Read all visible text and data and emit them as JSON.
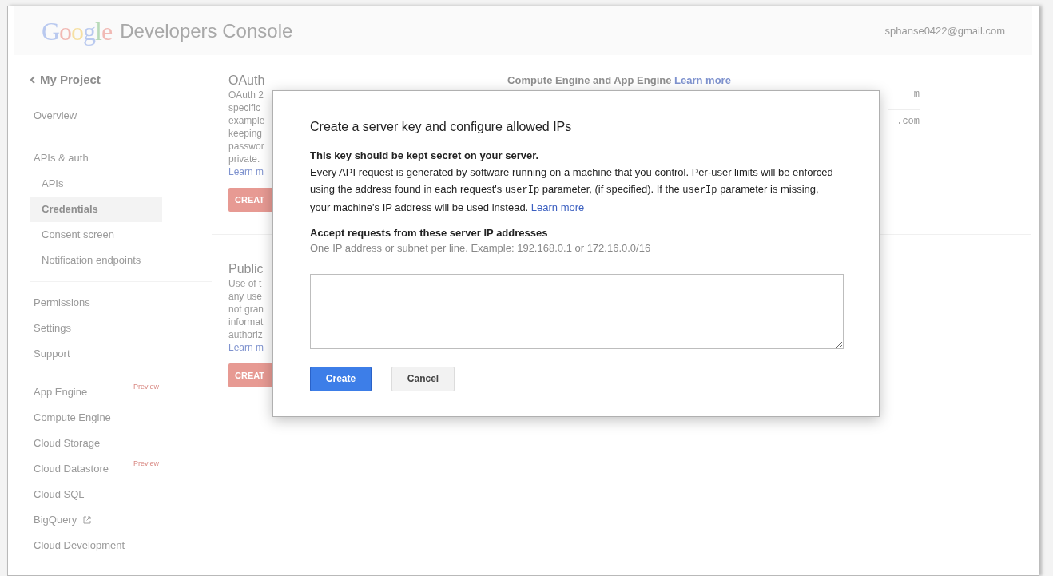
{
  "header": {
    "logo": "Google",
    "product": "Developers Console",
    "account": "sphanse0422@gmail.com"
  },
  "sidebar": {
    "back_label": "My Project",
    "groups": [
      {
        "items": [
          {
            "label": "Overview",
            "selected": false
          }
        ]
      },
      {
        "items": [
          {
            "label": "APIs & auth",
            "selected": false,
            "children": [
              {
                "label": "APIs",
                "selected": false
              },
              {
                "label": "Credentials",
                "selected": true
              },
              {
                "label": "Consent screen",
                "selected": false
              },
              {
                "label": "Notification endpoints",
                "selected": false
              }
            ]
          }
        ]
      },
      {
        "items": [
          {
            "label": "Permissions",
            "selected": false
          },
          {
            "label": "Settings",
            "selected": false
          },
          {
            "label": "Support",
            "selected": false
          }
        ]
      },
      {
        "items": [
          {
            "label": "App Engine",
            "selected": false,
            "badge": "Preview"
          },
          {
            "label": "Compute Engine",
            "selected": false
          },
          {
            "label": "Cloud Storage",
            "selected": false
          },
          {
            "label": "Cloud Datastore",
            "selected": false,
            "badge": "Preview"
          },
          {
            "label": "Cloud SQL",
            "selected": false
          },
          {
            "label": "BigQuery",
            "selected": false,
            "external": true
          },
          {
            "label": "Cloud Development",
            "selected": false
          }
        ]
      }
    ]
  },
  "background": {
    "sections": [
      {
        "title": "OAuth",
        "lines": [
          "OAuth 2",
          "specific",
          "example",
          "keeping",
          "passwor",
          "private."
        ],
        "link": "Learn m",
        "button": "CREAT"
      },
      {
        "title": "Public",
        "lines": [
          "Use of t",
          "any use",
          "not gran",
          "informat",
          "authoriz"
        ],
        "link": "Learn m",
        "button": "CREAT"
      }
    ],
    "heading": {
      "text": "Compute Engine and App Engine",
      "link": "Learn more"
    },
    "right_fragments": [
      {
        "kind": "text",
        "text": "m"
      },
      {
        "kind": "field",
        "text": ".com"
      }
    ]
  },
  "dialog": {
    "title": "Create a server key and configure allowed IPs",
    "warning": "This key should be kept secret on your server.",
    "description": [
      {
        "kind": "text",
        "text": "Every API request is generated by software running on a machine that you control. Per-user limits will be enforced using the address found in each request's "
      },
      {
        "kind": "code",
        "text": "userIp"
      },
      {
        "kind": "text",
        "text": " parameter, (if specified). If the "
      },
      {
        "kind": "code",
        "text": "userIp"
      },
      {
        "kind": "text",
        "text": " parameter is missing, your machine's IP address will be used instead. "
      },
      {
        "kind": "link",
        "text": "Learn more"
      }
    ],
    "field_label": "Accept requests from these server IP addresses",
    "field_hint": "One IP address or subnet per line. Example: 192.168.0.1 or 172.16.0.0/16",
    "buttons": [
      {
        "label": "Create",
        "kind": "primary"
      },
      {
        "label": "Cancel",
        "kind": "secondary"
      }
    ]
  }
}
